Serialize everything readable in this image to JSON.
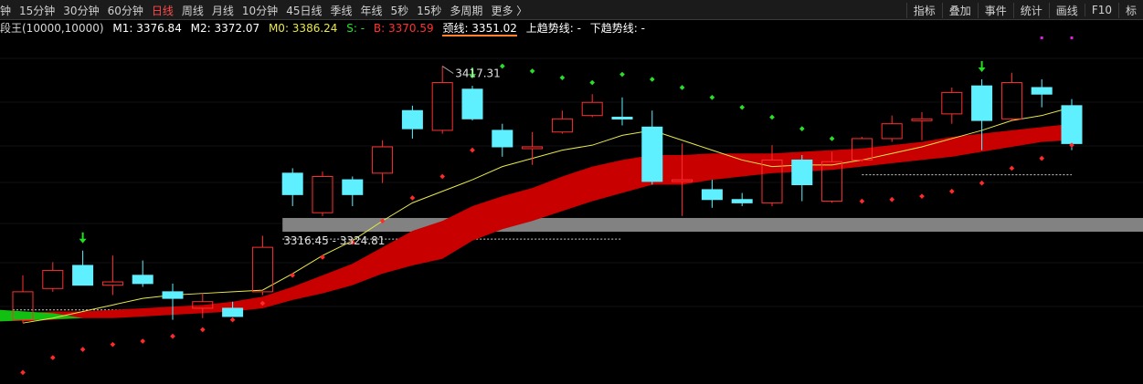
{
  "toolbar": {
    "periods": [
      "钟",
      "15分钟",
      "30分钟",
      "60分钟",
      "日线",
      "周线",
      "月线",
      "10分钟",
      "45日线",
      "季线",
      "年线",
      "5秒",
      "15秒",
      "多周期",
      "更多 〉"
    ],
    "active_period": "日线",
    "tools": [
      "指标",
      "叠加",
      "事件",
      "统计",
      "画线",
      "F10",
      "标"
    ]
  },
  "legend": {
    "name": "段王(10000,10000)",
    "m1": "M1: 3376.84",
    "m2": "M2: 3372.07",
    "m0": "M0: 3386.24",
    "s": "S: -",
    "b": "B: 3370.59",
    "neck": "颈线: 3351.02",
    "up": "上趋势线: -",
    "down": "下趋势线: -"
  },
  "colors": {
    "up_candle": "#ff3030",
    "down_candle": "#5ff0ff",
    "ma": "#e8e84a",
    "ribbon_red": "#c80000",
    "ribbon_green": "#12c012",
    "dot_red": "#ff2a2a",
    "dot_green": "#28e028",
    "zone_gray": "#828282",
    "arrow": "#22dd22",
    "magenta": "#e020e0"
  },
  "chart_data": {
    "type": "candlestick",
    "annotations": {
      "high_label": "3417.31",
      "zone_label": "3316.45 - 3324.81"
    },
    "ylim": [
      3224.0,
      3435.0
    ],
    "zone": [
      3316.45,
      3324.81
    ],
    "neckline": 3351.02,
    "candles": [
      {
        "o": 3263.0,
        "h": 3290.0,
        "l": 3261.0,
        "c": 3280.0
      },
      {
        "o": 3282.0,
        "h": 3298.0,
        "l": 3280.0,
        "c": 3293.0
      },
      {
        "o": 3296.0,
        "h": 3305.0,
        "l": 3287.0,
        "c": 3284.0
      },
      {
        "o": 3284.0,
        "h": 3302.0,
        "l": 3278.0,
        "c": 3286.0
      },
      {
        "o": 3290.0,
        "h": 3299.0,
        "l": 3283.0,
        "c": 3285.0
      },
      {
        "o": 3280.0,
        "h": 3285.0,
        "l": 3263.0,
        "c": 3276.0
      },
      {
        "o": 3270.0,
        "h": 3279.0,
        "l": 3264.0,
        "c": 3274.0
      },
      {
        "o": 3270.0,
        "h": 3274.0,
        "l": 3266.0,
        "c": 3265.0
      },
      {
        "o": 3280.0,
        "h": 3314.0,
        "l": 3278.0,
        "c": 3307.0
      },
      {
        "o": 3352.0,
        "h": 3355.0,
        "l": 3332.0,
        "c": 3339.0
      },
      {
        "o": 3328.0,
        "h": 3353.0,
        "l": 3326.0,
        "c": 3350.0
      },
      {
        "o": 3348.0,
        "h": 3350.0,
        "l": 3332.0,
        "c": 3339.0
      },
      {
        "o": 3352.0,
        "h": 3372.0,
        "l": 3346.0,
        "c": 3368.0
      },
      {
        "o": 3390.0,
        "h": 3393.0,
        "l": 3373.0,
        "c": 3379.0
      },
      {
        "o": 3378.0,
        "h": 3417.0,
        "l": 3376.0,
        "c": 3407.0
      },
      {
        "o": 3403.0,
        "h": 3405.0,
        "l": 3384.0,
        "c": 3385.0
      },
      {
        "o": 3378.0,
        "h": 3382.0,
        "l": 3362.0,
        "c": 3368.0
      },
      {
        "o": 3367.0,
        "h": 3377.0,
        "l": 3357.0,
        "c": 3368.0
      },
      {
        "o": 3377.0,
        "h": 3390.0,
        "l": 3376.0,
        "c": 3385.0
      },
      {
        "o": 3387.0,
        "h": 3400.0,
        "l": 3386.0,
        "c": 3395.0
      },
      {
        "o": 3386.0,
        "h": 3398.0,
        "l": 3381.0,
        "c": 3385.0
      },
      {
        "o": 3380.0,
        "h": 3390.0,
        "l": 3345.0,
        "c": 3347.0
      },
      {
        "o": 3347.0,
        "h": 3370.0,
        "l": 3326.0,
        "c": 3348.0
      },
      {
        "o": 3342.0,
        "h": 3348.0,
        "l": 3331.0,
        "c": 3336.0
      },
      {
        "o": 3336.0,
        "h": 3340.0,
        "l": 3332.0,
        "c": 3334.0
      },
      {
        "o": 3334.0,
        "h": 3369.0,
        "l": 3332.0,
        "c": 3360.0
      },
      {
        "o": 3360.0,
        "h": 3363.0,
        "l": 3335.0,
        "c": 3345.0
      },
      {
        "o": 3335.0,
        "h": 3365.0,
        "l": 3334.0,
        "c": 3359.0
      },
      {
        "o": 3360.0,
        "h": 3374.0,
        "l": 3359.0,
        "c": 3373.0
      },
      {
        "o": 3373.0,
        "h": 3387.0,
        "l": 3371.0,
        "c": 3382.0
      },
      {
        "o": 3384.0,
        "h": 3389.0,
        "l": 3372.0,
        "c": 3385.0
      },
      {
        "o": 3388.0,
        "h": 3404.0,
        "l": 3382.0,
        "c": 3401.0
      },
      {
        "o": 3405.0,
        "h": 3409.0,
        "l": 3366.0,
        "c": 3384.0
      },
      {
        "o": 3385.0,
        "h": 3413.0,
        "l": 3384.0,
        "c": 3407.0
      },
      {
        "o": 3404.0,
        "h": 3409.0,
        "l": 3392.0,
        "c": 3400.0
      },
      {
        "o": 3393.0,
        "h": 3397.0,
        "l": 3366.0,
        "c": 3370.0
      }
    ],
    "ma": [
      3261,
      3264,
      3268,
      3272,
      3276,
      3278,
      3279,
      3280,
      3281,
      3291,
      3302,
      3311,
      3323,
      3334,
      3341,
      3348,
      3356,
      3361,
      3366,
      3369,
      3375,
      3378,
      3372,
      3366,
      3360,
      3356,
      3357,
      3357,
      3360,
      3364,
      3368,
      3373,
      3378,
      3384,
      3387,
      3392
    ],
    "ribbon": [
      {
        "u": 3267,
        "l": 3262
      },
      {
        "u": 3268,
        "l": 3263
      },
      {
        "u": 3268,
        "l": 3264
      },
      {
        "u": 3269,
        "l": 3264
      },
      {
        "u": 3270,
        "l": 3265
      },
      {
        "u": 3271,
        "l": 3266
      },
      {
        "u": 3272,
        "l": 3267
      },
      {
        "u": 3274,
        "l": 3268
      },
      {
        "u": 3277,
        "l": 3270
      },
      {
        "u": 3283,
        "l": 3275
      },
      {
        "u": 3290,
        "l": 3279
      },
      {
        "u": 3297,
        "l": 3284
      },
      {
        "u": 3307,
        "l": 3291
      },
      {
        "u": 3317,
        "l": 3296
      },
      {
        "u": 3323,
        "l": 3300
      },
      {
        "u": 3332,
        "l": 3311
      },
      {
        "u": 3338,
        "l": 3318
      },
      {
        "u": 3343,
        "l": 3323
      },
      {
        "u": 3350,
        "l": 3329
      },
      {
        "u": 3356,
        "l": 3335
      },
      {
        "u": 3360,
        "l": 3340
      },
      {
        "u": 3363,
        "l": 3345
      },
      {
        "u": 3363,
        "l": 3345
      },
      {
        "u": 3364,
        "l": 3348
      },
      {
        "u": 3364,
        "l": 3350
      },
      {
        "u": 3364,
        "l": 3352
      },
      {
        "u": 3365,
        "l": 3353
      },
      {
        "u": 3366,
        "l": 3354
      },
      {
        "u": 3367,
        "l": 3356
      },
      {
        "u": 3369,
        "l": 3358
      },
      {
        "u": 3371,
        "l": 3360
      },
      {
        "u": 3374,
        "l": 3362
      },
      {
        "u": 3376,
        "l": 3365
      },
      {
        "u": 3378,
        "l": 3368
      },
      {
        "u": 3380,
        "l": 3371
      },
      {
        "u": 3382,
        "l": 3372
      }
    ],
    "green_ribbon": [
      {
        "u": 3269,
        "l": 3262
      },
      {
        "u": 3267,
        "l": 3264
      }
    ],
    "dots": [
      {
        "i": 0,
        "v": 3231,
        "c": "red"
      },
      {
        "i": 1,
        "v": 3240,
        "c": "red"
      },
      {
        "i": 2,
        "v": 3245,
        "c": "red"
      },
      {
        "i": 3,
        "v": 3248,
        "c": "red"
      },
      {
        "i": 4,
        "v": 3250,
        "c": "red"
      },
      {
        "i": 5,
        "v": 3253,
        "c": "red"
      },
      {
        "i": 6,
        "v": 3257,
        "c": "red"
      },
      {
        "i": 7,
        "v": 3263,
        "c": "red"
      },
      {
        "i": 8,
        "v": 3273,
        "c": "red"
      },
      {
        "i": 9,
        "v": 3290,
        "c": "red"
      },
      {
        "i": 10,
        "v": 3301,
        "c": "red"
      },
      {
        "i": 11,
        "v": 3310,
        "c": "red"
      },
      {
        "i": 12,
        "v": 3323,
        "c": "red"
      },
      {
        "i": 13,
        "v": 3337,
        "c": "red"
      },
      {
        "i": 14,
        "v": 3350,
        "c": "red"
      },
      {
        "i": 15,
        "v": 3366,
        "c": "red"
      },
      {
        "i": 16,
        "v": 3417,
        "c": "green"
      },
      {
        "i": 17,
        "v": 3414,
        "c": "green"
      },
      {
        "i": 18,
        "v": 3410,
        "c": "green"
      },
      {
        "i": 19,
        "v": 3407,
        "c": "green"
      },
      {
        "i": 20,
        "v": 3412,
        "c": "green"
      },
      {
        "i": 21,
        "v": 3409,
        "c": "green"
      },
      {
        "i": 22,
        "v": 3404,
        "c": "green"
      },
      {
        "i": 23,
        "v": 3398,
        "c": "green"
      },
      {
        "i": 24,
        "v": 3392,
        "c": "green"
      },
      {
        "i": 25,
        "v": 3386,
        "c": "green"
      },
      {
        "i": 26,
        "v": 3379,
        "c": "green"
      },
      {
        "i": 27,
        "v": 3373,
        "c": "green"
      },
      {
        "i": 28,
        "v": 3335,
        "c": "red"
      },
      {
        "i": 29,
        "v": 3336,
        "c": "red"
      },
      {
        "i": 30,
        "v": 3338,
        "c": "red"
      },
      {
        "i": 31,
        "v": 3341,
        "c": "red"
      },
      {
        "i": 32,
        "v": 3346,
        "c": "red"
      },
      {
        "i": 33,
        "v": 3355,
        "c": "red"
      },
      {
        "i": 34,
        "v": 3361,
        "c": "red"
      },
      {
        "i": 35,
        "v": 3369,
        "c": "red"
      }
    ],
    "magenta_marks": [
      34,
      35
    ],
    "arrows": [
      2,
      15,
      32
    ],
    "neck_segment": [
      28,
      35
    ],
    "zone_segment": [
      9,
      35
    ],
    "dashed_lines": [
      {
        "v": 3312,
        "from": 9,
        "to": 20
      },
      {
        "v": 3269,
        "from": 0,
        "to": 6
      }
    ]
  }
}
